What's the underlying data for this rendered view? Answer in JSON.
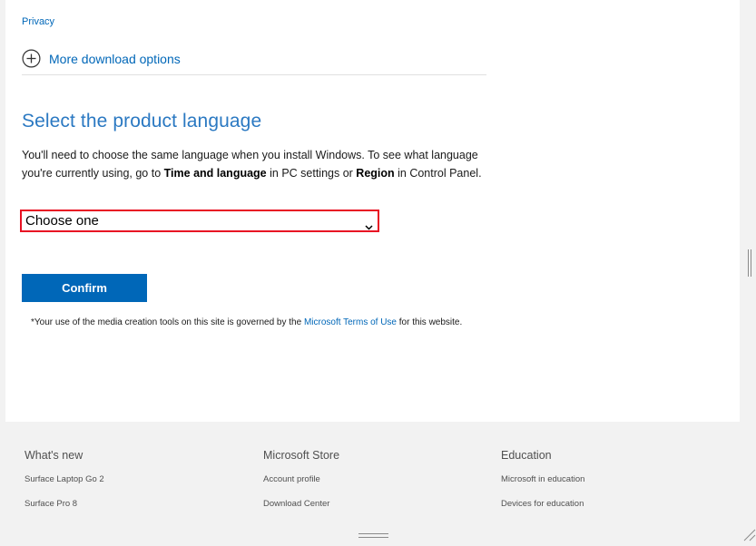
{
  "header": {
    "privacy_label": "Privacy",
    "more_options_label": "More download options"
  },
  "language_section": {
    "title": "Select the product language",
    "description_part1": "You'll need to choose the same language when you install Windows. To see what language you're currently using, go to ",
    "description_bold1": "Time and language",
    "description_part2": " in PC settings or ",
    "description_bold2": "Region",
    "description_part3": " in Control Panel.",
    "select_value": "Choose one",
    "confirm_label": "Confirm"
  },
  "terms": {
    "prefix": "*Your use of the media creation tools on this site is governed by the ",
    "link": "Microsoft Terms of Use",
    "suffix": " for this website."
  },
  "footer": {
    "columns": [
      {
        "heading": "What's new",
        "items": [
          "Surface Laptop Go 2",
          "Surface Pro 8"
        ]
      },
      {
        "heading": "Microsoft Store",
        "items": [
          "Account profile",
          "Download Center"
        ]
      },
      {
        "heading": "Education",
        "items": [
          "Microsoft in education",
          "Devices for education"
        ]
      }
    ]
  },
  "colors": {
    "accent": "#0067b8",
    "title": "#2b79c2",
    "highlight_border": "#e81123",
    "footer_bg": "#f2f2f2"
  },
  "icons": [
    "plus-circle-icon",
    "chevron-down-icon",
    "resize-grip-icon"
  ]
}
